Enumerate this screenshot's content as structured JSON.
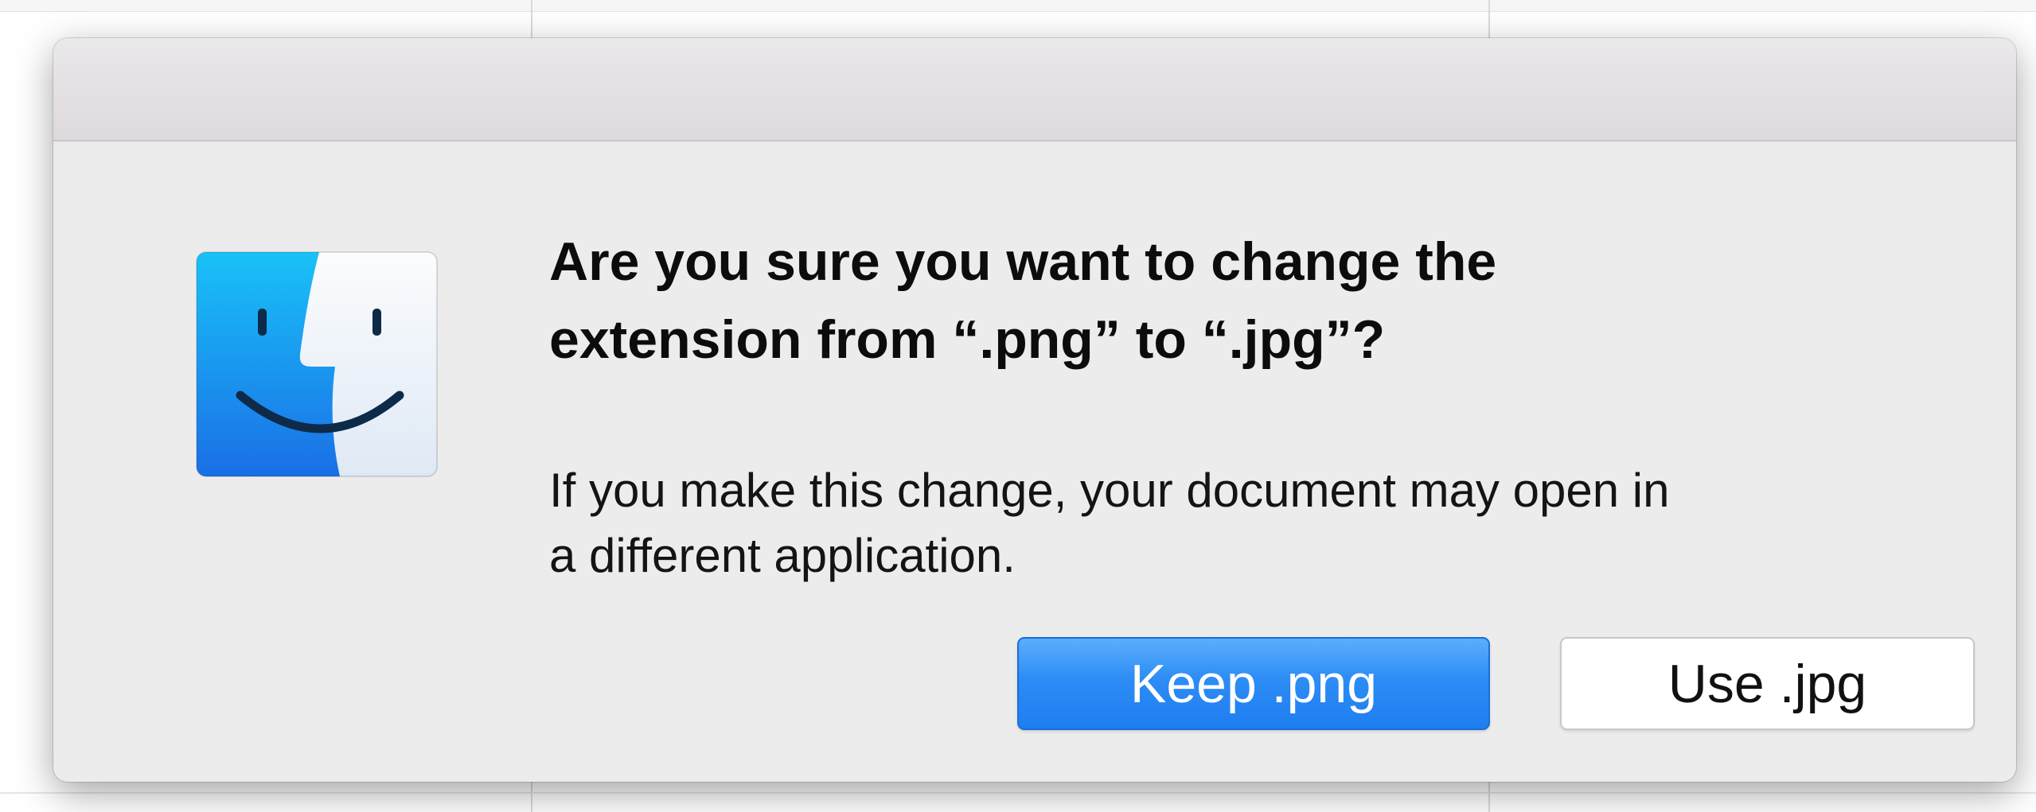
{
  "alert": {
    "icon": "finder-icon",
    "headline_line1": "Are you sure you want to change the",
    "headline_line2": "extension from “.png” to “.jpg”?",
    "message_line1": "If you make this change, your document may open in",
    "message_line2": "a different application.",
    "buttons": {
      "primary_label": "Keep .png",
      "secondary_label": "Use .jpg"
    }
  },
  "colors": {
    "accent": "#2d8cf5",
    "sheet_background": "#ececec",
    "finder_blue": "#1f86ee",
    "finder_light": "#eef3f9"
  }
}
